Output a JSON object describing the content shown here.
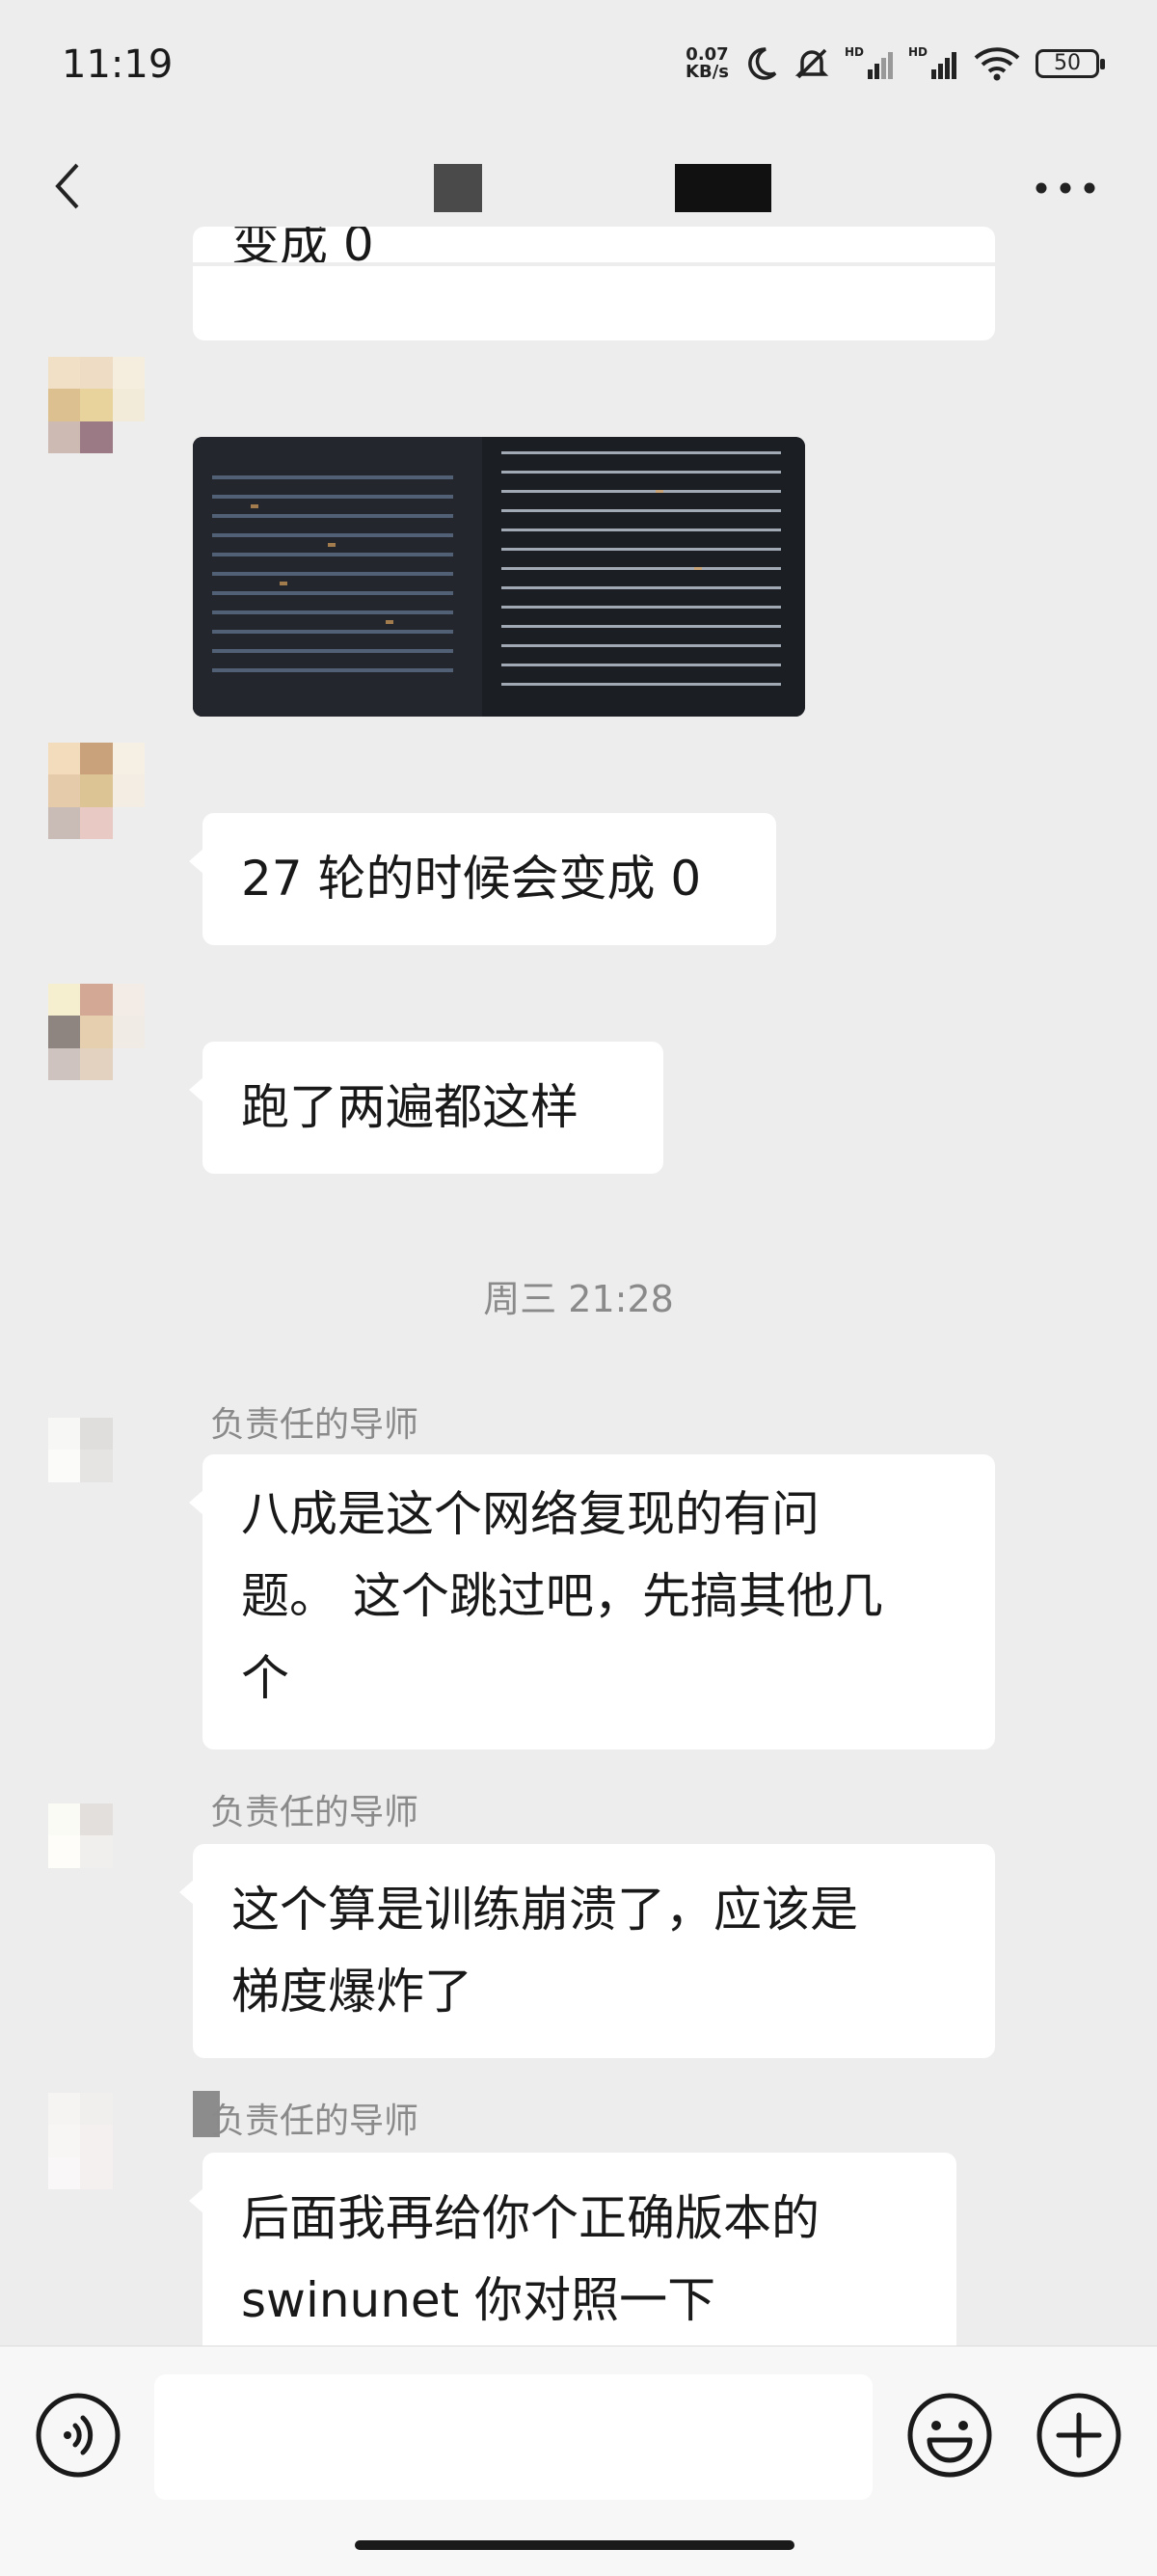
{
  "status_bar": {
    "time": "11:19",
    "net_speed_value": "0.07",
    "net_speed_unit": "KB/s",
    "battery": "50"
  },
  "header": {
    "back_icon": "chevron-left-icon",
    "more_icon": "ellipsis-icon"
  },
  "messages": [
    {
      "text": "变成 0"
    },
    {
      "type": "image"
    },
    {
      "text": "27 轮的时候会变成 0"
    },
    {
      "text": "跑了两遍都这样"
    },
    {
      "sender": "负责任的导师",
      "text_lines": [
        "八成是这个网络复现的有问",
        "题。 这个跳过吧，先搞其他几",
        "个"
      ]
    },
    {
      "sender": "负责任的导师",
      "text_lines": [
        "这个算是训练崩溃了，应该是",
        "梯度爆炸了"
      ]
    },
    {
      "sender": "负责任的导师",
      "text_lines": [
        "后面我再给你个正确版本的",
        "swinunet 你对照一下"
      ]
    }
  ],
  "timestamp": "周三 21:28",
  "input_bar": {
    "voice_icon": "voice-icon",
    "emoji_icon": "emoji-icon",
    "add_icon": "plus-circle-icon",
    "input_value": ""
  }
}
